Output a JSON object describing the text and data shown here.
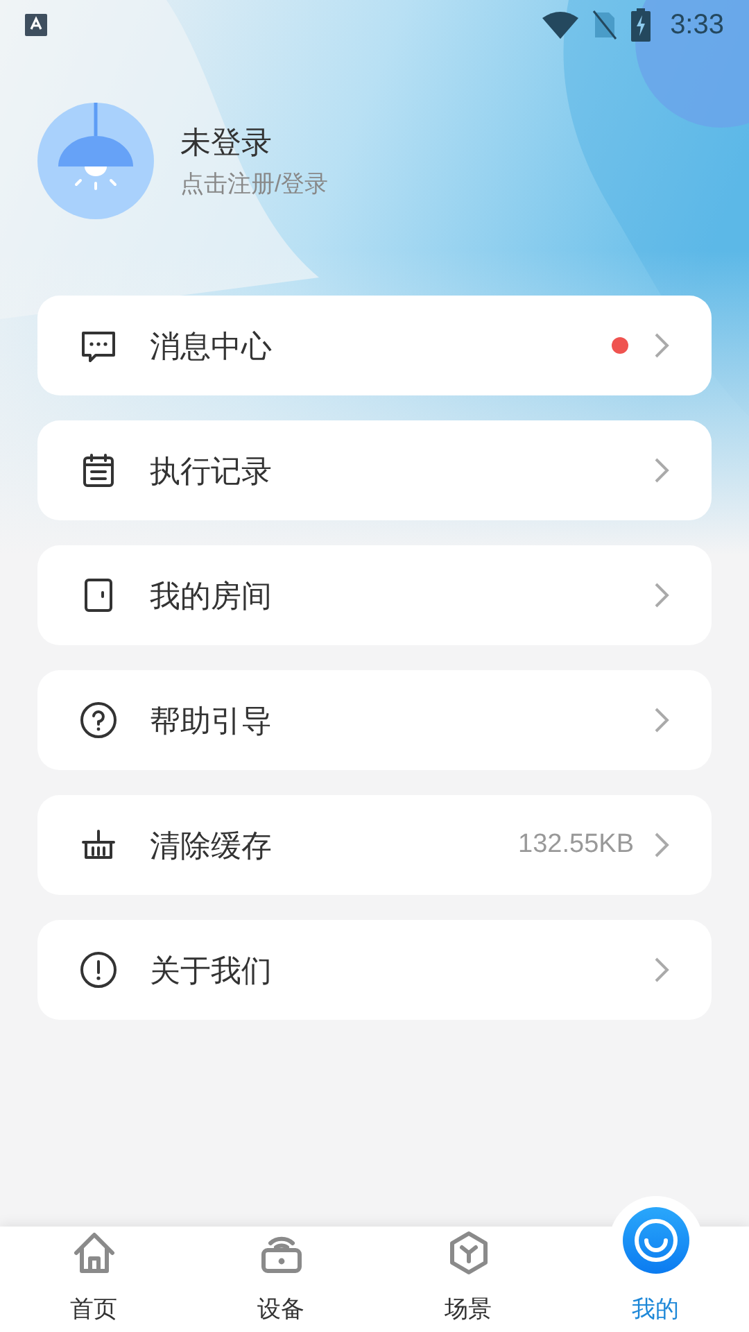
{
  "status_bar": {
    "time": "3:33"
  },
  "profile": {
    "title": "未登录",
    "subtitle": "点击注册/登录"
  },
  "menu": [
    {
      "label": "消息中心",
      "unread": true
    },
    {
      "label": "执行记录",
      "unread": false
    },
    {
      "label": "我的房间",
      "unread": false
    },
    {
      "label": "帮助引导",
      "unread": false
    },
    {
      "label": "清除缓存",
      "unread": false,
      "value": "132.55KB"
    },
    {
      "label": "关于我们",
      "unread": false
    }
  ],
  "tabs": [
    {
      "label": "首页",
      "selected": false
    },
    {
      "label": "设备",
      "selected": false
    },
    {
      "label": "场景",
      "selected": false
    },
    {
      "label": "我的",
      "selected": true
    }
  ]
}
